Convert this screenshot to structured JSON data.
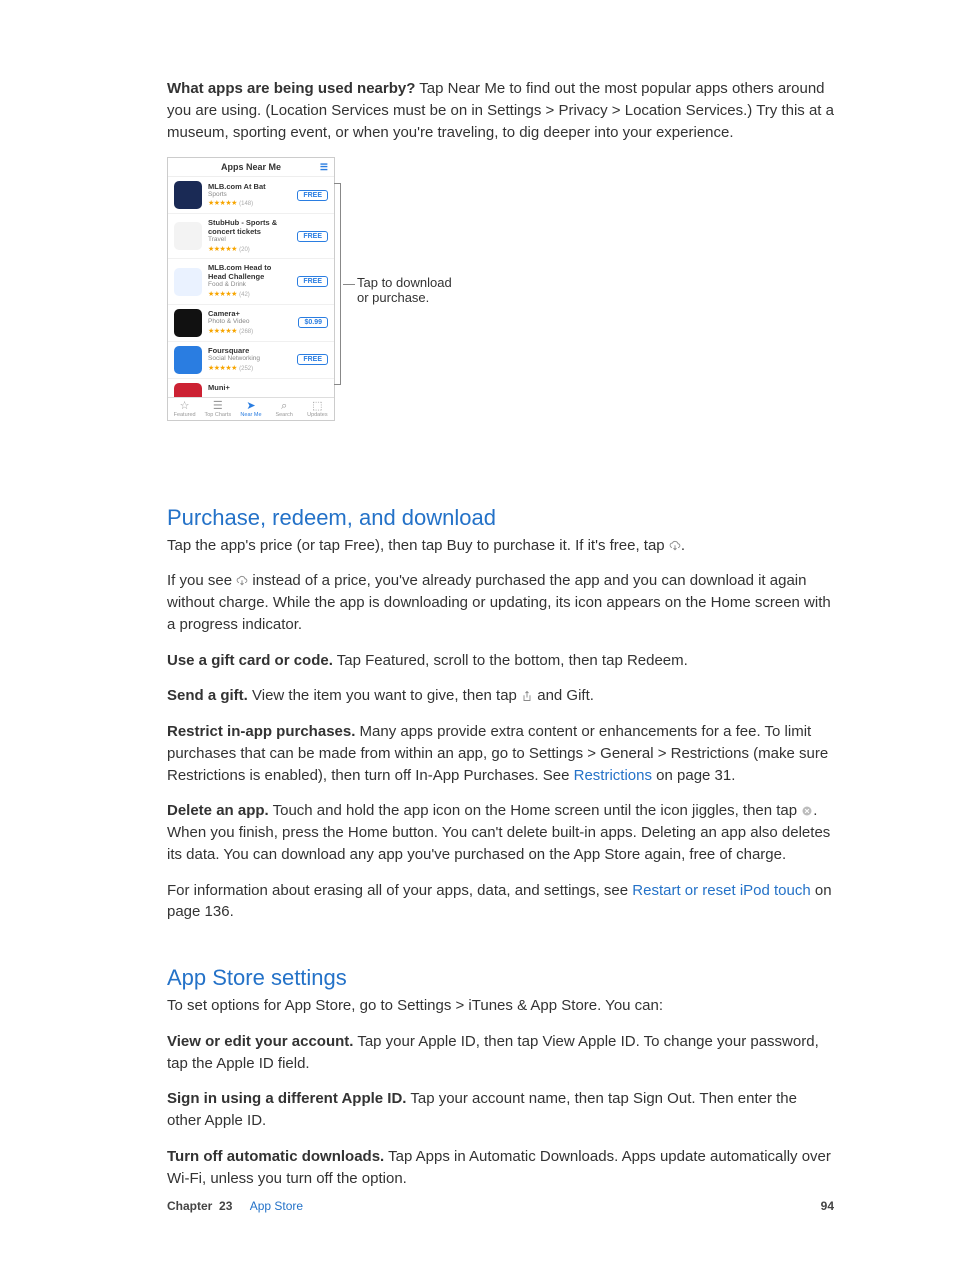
{
  "intro": {
    "lead": "What apps are being used nearby?",
    "body": " Tap Near Me to find out the most popular apps others around you are using. (Location Services must be on in Settings > Privacy > Location Services.) Try this at a museum, sporting event, or when you're traveling, to dig deeper into your experience."
  },
  "screenshot": {
    "title": "Apps Near Me",
    "apps": [
      {
        "name": "MLB.com At Bat",
        "category": "Sports",
        "count": "(148)",
        "price": "FREE",
        "icon_bg": "#1a2a55"
      },
      {
        "name": "StubHub - Sports & concert tickets",
        "category": "Travel",
        "count": "(20)",
        "price": "FREE",
        "icon_bg": "#f3f3f3"
      },
      {
        "name": "MLB.com Head to Head Challenge",
        "category": "Food & Drink",
        "count": "(42)",
        "price": "FREE",
        "icon_bg": "#eaf2ff"
      },
      {
        "name": "Camera+",
        "category": "Photo & Video",
        "count": "(268)",
        "price": "$0.99",
        "icon_bg": "#111"
      },
      {
        "name": "Foursquare",
        "category": "Social Networking",
        "count": "(252)",
        "price": "FREE",
        "icon_bg": "#2a7de1"
      }
    ],
    "partial_app": "Muni+",
    "tabs": [
      "Featured",
      "Top Charts",
      "Near Me",
      "Search",
      "Updates"
    ],
    "callout_line1": "Tap to download",
    "callout_line2": "or purchase."
  },
  "section1": {
    "heading": "Purchase, redeem, and download",
    "p1a": "Tap the app's price (or tap Free), then tap Buy to purchase it. If it's free, tap ",
    "p1b": ".",
    "p2a": "If you see ",
    "p2b": " instead of a price, you've already purchased the app and you can download it again without charge. While the app is downloading or updating, its icon appears on the Home screen with a progress indicator.",
    "p3_lead": "Use a gift card or code.",
    "p3": " Tap Featured, scroll to the bottom, then tap Redeem.",
    "p4_lead": "Send a gift.",
    "p4a": " View the item you want to give, then tap ",
    "p4b": " and Gift.",
    "p5_lead": "Restrict in-app purchases.",
    "p5a": " Many apps provide extra content or enhancements for a fee. To limit purchases that can be made from within an app, go to Settings > General > Restrictions (make sure Restrictions is enabled), then turn off In-App Purchases. See ",
    "p5_link": "Restrictions",
    "p5b": " on page 31.",
    "p6_lead": "Delete an app.",
    "p6a": " Touch and hold the app icon on the Home screen until the icon jiggles, then tap ",
    "p6b": ". When you finish, press the Home button. You can't delete built-in apps. Deleting an app also deletes its data. You can download any app you've purchased on the App Store again, free of charge.",
    "p7a": "For information about erasing all of your apps, data, and settings, see ",
    "p7_link": "Restart or reset iPod touch",
    "p7b": " on page 136."
  },
  "section2": {
    "heading": "App Store settings",
    "p1": "To set options for App Store, go to Settings > iTunes & App Store. You can:",
    "p2_lead": "View or edit your account.",
    "p2": " Tap your Apple ID, then tap View Apple ID. To change your password, tap the Apple ID field.",
    "p3_lead": "Sign in using a different Apple ID.",
    "p3": " Tap your account name, then tap Sign Out. Then enter the other Apple ID.",
    "p4_lead": "Turn off automatic downloads.",
    "p4": " Tap Apps in Automatic Downloads. Apps update automatically over Wi-Fi, unless you turn off the option."
  },
  "footer": {
    "chapter_label": "Chapter",
    "chapter_num": "23",
    "chapter_name": "App Store",
    "page_num": "94"
  }
}
